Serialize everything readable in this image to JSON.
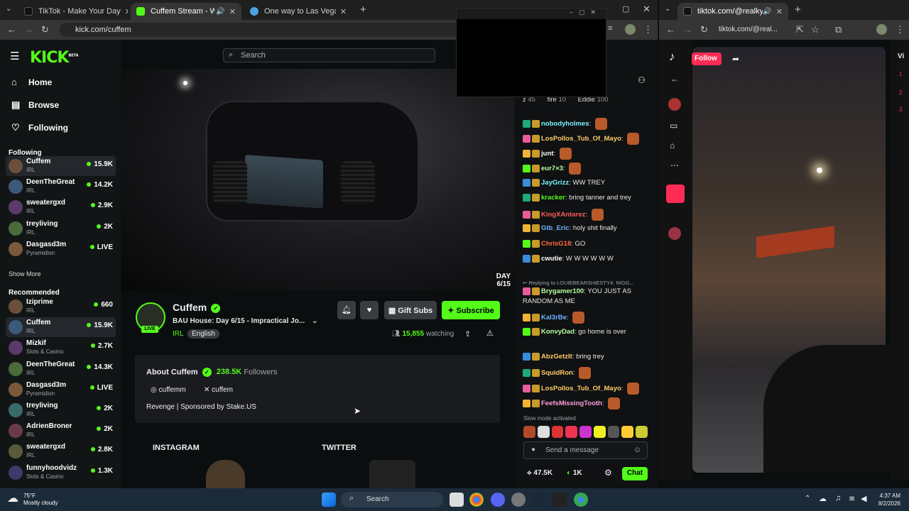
{
  "left_browser": {
    "tabs": [
      {
        "label": "TikTok - Make Your Day",
        "active": false
      },
      {
        "label": "Cuffem Stream - Watch Live",
        "active": true
      },
      {
        "label": "One way to Las Vegas | Google",
        "active": false
      }
    ],
    "url": "kick.com/cuffem"
  },
  "kick": {
    "logo": "KICK",
    "logo_sup": "BETA",
    "search_placeholder": "Search",
    "nav": [
      {
        "label": "Home",
        "icon": "home-icon"
      },
      {
        "label": "Browse",
        "icon": "browse-icon"
      },
      {
        "label": "Following",
        "icon": "heart-icon"
      }
    ],
    "following_title": "Following",
    "following": [
      {
        "name": "Cuffem",
        "category": "IRL",
        "viewers": "15.9K",
        "selected": true
      },
      {
        "name": "DeenTheGreat",
        "category": "IRL",
        "viewers": "14.2K"
      },
      {
        "name": "sweatergxd",
        "category": "IRL",
        "viewers": "2.9K"
      },
      {
        "name": "treyliving",
        "category": "IRL",
        "viewers": "2K"
      },
      {
        "name": "Dasgasd3m",
        "category": "Pyramidion",
        "viewers": "LIVE"
      }
    ],
    "show_more": "Show More",
    "recommended_title": "Recommended",
    "recommended": [
      {
        "name": "Iziprime",
        "category": "IRL",
        "viewers": "660"
      },
      {
        "name": "Cuffem",
        "category": "IRL",
        "viewers": "15.9K",
        "selected": true
      },
      {
        "name": "Mizkif",
        "category": "Slots & Casino",
        "viewers": "2.7K"
      },
      {
        "name": "DeenTheGreat",
        "category": "IRL",
        "viewers": "14.3K"
      },
      {
        "name": "Dasgasd3m",
        "category": "Pyramidion",
        "viewers": "LIVE"
      },
      {
        "name": "treyliving",
        "category": "IRL",
        "viewers": "2K"
      },
      {
        "name": "AdrienBroner",
        "category": "IRL",
        "viewers": "2K"
      },
      {
        "name": "sweatergxd",
        "category": "IRL",
        "viewers": "2.8K"
      },
      {
        "name": "funnyhoodvidz",
        "category": "Slots & Casino",
        "viewers": "1.3K"
      }
    ],
    "video_day_tag": "DAY",
    "video_day_value": "6/15",
    "streamer": {
      "name": "Cuffem",
      "live": "LIVE",
      "title": "BAU House: Day 6/15 - Impractical Jo...",
      "category": "IRL",
      "language": "English",
      "gift_subs": "Gift Subs",
      "subscribe": "Subscribe",
      "watching_count": "15,855",
      "watching_label": "watching"
    },
    "about": {
      "title": "About Cuffem",
      "followers_count": "238.5K",
      "followers_label": "Followers",
      "instagram": "cuffemm",
      "twitter": "cuffem",
      "description": "Revenge | Sponsored by Stake.US"
    },
    "panels": {
      "instagram": "INSTAGRAM",
      "twitter": "TWITTER"
    },
    "header_coins": "00",
    "top_gifters": [
      {
        "name": "z",
        "count": "45"
      },
      {
        "name": "fire",
        "count": "10"
      },
      {
        "name": "Eddie",
        "count": "100"
      }
    ],
    "chat": [
      {
        "user": "nobodyholmes",
        "color": "#7df5ff",
        "text": ""
      },
      {
        "user": "LosPollos_Tub_Of_Mayo",
        "color": "#ffcc66",
        "text": ""
      },
      {
        "user": "junt",
        "color": "#ffffff",
        "text": ""
      },
      {
        "user": "eur7×3",
        "color": "#b8ff9f",
        "text": ""
      },
      {
        "user": "JayGrizz",
        "color": "#7df5ff",
        "text": "WW TREY"
      },
      {
        "user": "kracker",
        "color": "#53fc18",
        "text": "bring tanner and trey"
      },
      {
        "user": "KingXAntarez",
        "color": "#ff5b5b",
        "text": ""
      },
      {
        "user": "Gtb_Eric",
        "color": "#6fb3ff",
        "text": "holy shit finally"
      },
      {
        "user": "ChrisG18",
        "color": "#ff6a3d",
        "text": "GO"
      },
      {
        "user": "cwutie",
        "color": "#ffffff",
        "text": "W W W W W W"
      },
      {
        "reply": "Replying to LOUIEBEARSHIESTY4: NIGG..."
      },
      {
        "user": "Brygamer100",
        "color": "#b8ff9f",
        "text": "YOU JUST AS RANDOM AS ME"
      },
      {
        "user": "Kal3rBe",
        "color": "#6fb3ff",
        "text": ""
      },
      {
        "user": "KonvyDad",
        "color": "#b8ff9f",
        "text": "go home is over"
      },
      {
        "user": "AbzGetzIt",
        "color": "#ffcc66",
        "text": "bring trey"
      },
      {
        "user": "SquidRon",
        "color": "#ffcc66",
        "text": ""
      },
      {
        "user": "LosPollos_Tub_Of_Mayo",
        "color": "#ffcc66",
        "text": ""
      },
      {
        "user": "FeefsMissingTooth",
        "color": "#ff9ee0",
        "text": ""
      }
    ],
    "slow_mode": "Slow mode activated",
    "chat_placeholder": "Send a message",
    "chat_button": "Chat",
    "footer_stat_1": "47.5K",
    "footer_stat_2": "1K"
  },
  "right_browser": {
    "tab_label": "tiktok.com/@realkylewong",
    "url": "tiktok.com/@real...",
    "follow": "Follow",
    "side_label": "Vi",
    "side_nums": [
      "1",
      "2",
      "3"
    ]
  },
  "taskbar": {
    "weather_temp": "75°F",
    "weather_desc": "Mostly cloudy",
    "search": "Search",
    "time": "4:37 AM",
    "date": "8/2/2026"
  },
  "colors": {
    "kick_green": "#53fc18",
    "tiktok_red": "#fe2c55"
  }
}
